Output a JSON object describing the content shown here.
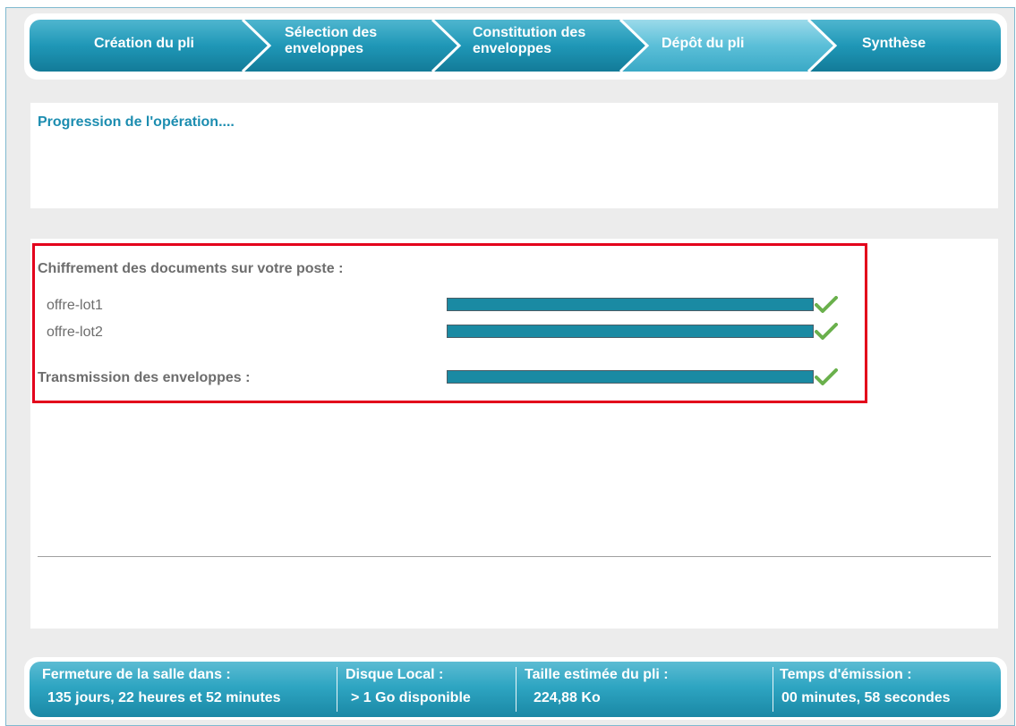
{
  "wizard": {
    "steps": [
      {
        "label_line1": "Création du pli",
        "label_line2": ""
      },
      {
        "label_line1": "Sélection des",
        "label_line2": "enveloppes"
      },
      {
        "label_line1": "Constitution des",
        "label_line2": "enveloppes"
      },
      {
        "label_line1": "Dépôt du pli",
        "label_line2": ""
      },
      {
        "label_line1": "Synthèse",
        "label_line2": ""
      }
    ],
    "active_step": 3
  },
  "progress_panel": {
    "title": "Progression de l'opération...."
  },
  "encryption": {
    "title": "Chiffrement des documents sur votre poste :",
    "files": [
      {
        "name": "offre-lot1",
        "progress": 1.0,
        "status": "check-icon"
      },
      {
        "name": "offre-lot2",
        "progress": 1.0,
        "status": "check-icon"
      }
    ]
  },
  "transmission": {
    "title": "Transmission des enveloppes :",
    "progress": 1.0,
    "status": "check-icon"
  },
  "footer": {
    "closing_label": "Fermeture de la salle dans :",
    "closing_value": "135 jours, 22 heures et 52 minutes",
    "disk_label": "Disque Local :",
    "disk_value": "> 1 Go disponible",
    "size_label": "Taille estimée du pli :",
    "size_value": "224,88 Ko",
    "time_label": "Temps d'émission :",
    "time_value": "00 minutes, 58 secondes"
  },
  "colors": {
    "accent": "#1c8db0",
    "progress_fill": "#1a8aa3",
    "highlight": "#e3001b",
    "check": "#6ab04c"
  }
}
